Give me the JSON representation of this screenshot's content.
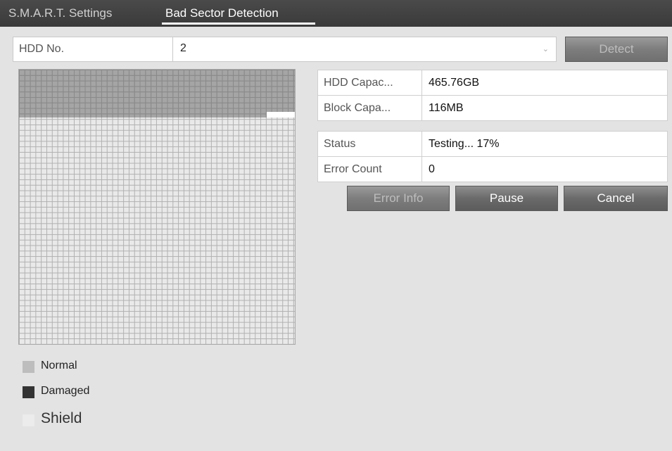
{
  "tabs": [
    {
      "label": "S.M.A.R.T. Settings",
      "active": false
    },
    {
      "label": "Bad Sector Detection",
      "active": true
    }
  ],
  "hdd": {
    "label": "HDD No.",
    "selected_value": "2",
    "chevron_icon": "chevron-down-icon"
  },
  "buttons": {
    "detect": "Detect",
    "error_info": "Error Info",
    "pause": "Pause",
    "cancel": "Cancel"
  },
  "capacity_info": [
    {
      "key": "HDD Capac...",
      "value": "465.76GB"
    },
    {
      "key": "Block Capa...",
      "value": "116MB"
    }
  ],
  "status_info": [
    {
      "key": "Status",
      "value": "Testing... 17%"
    },
    {
      "key": "Error Count",
      "value": "0"
    }
  ],
  "sector_map": {
    "progress_fraction": 0.17
  },
  "legend": [
    {
      "label": "Normal",
      "color": "#bdbdbd"
    },
    {
      "label": "Damaged",
      "color": "#333333"
    },
    {
      "label": "Shield",
      "color": "#ececec"
    }
  ]
}
